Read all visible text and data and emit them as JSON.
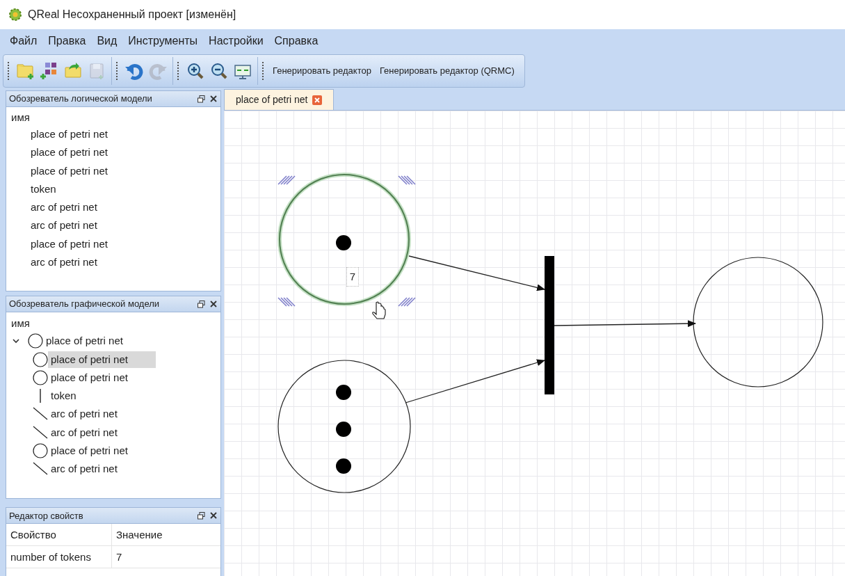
{
  "window": {
    "title": "QReal Несохраненный проект [изменён]"
  },
  "menu": [
    "Файл",
    "Правка",
    "Вид",
    "Инструменты",
    "Настройки",
    "Справка"
  ],
  "toolbar": {
    "groups": [
      [
        {
          "kind": "new-project",
          "disabled": false
        },
        {
          "kind": "new-diagram",
          "disabled": false
        },
        {
          "kind": "open",
          "disabled": false
        },
        {
          "kind": "save",
          "disabled": true
        }
      ],
      [
        {
          "kind": "undo",
          "disabled": false
        },
        {
          "kind": "redo",
          "disabled": true
        }
      ],
      [
        {
          "kind": "zoom-in",
          "disabled": false
        },
        {
          "kind": "zoom-out",
          "disabled": false
        },
        {
          "kind": "fit",
          "disabled": false
        }
      ]
    ],
    "actions": [
      "Генерировать редактор",
      "Генерировать редактор (QRMC)"
    ]
  },
  "logical_explorer": {
    "title": "Обозреватель логической модели",
    "header": "имя",
    "items": [
      "place of petri net",
      "place of petri net",
      "place of petri net",
      "token",
      "arc of petri net",
      "arc of petri net",
      "place of petri net",
      "arc of petri net"
    ]
  },
  "graphic_explorer": {
    "title": "Обозреватель графической модели",
    "header": "имя",
    "items": [
      {
        "label": "place of petri net",
        "kind": "place",
        "expanded": true,
        "selected": false,
        "children": [
          {
            "label": "place of petri net",
            "kind": "place",
            "selected": true
          },
          {
            "label": "place of petri net",
            "kind": "place",
            "selected": false
          },
          {
            "label": "token",
            "kind": "token",
            "selected": false
          },
          {
            "label": "arc of petri net",
            "kind": "arc",
            "selected": false
          },
          {
            "label": "arc of petri net",
            "kind": "arc",
            "selected": false
          },
          {
            "label": "place of petri net",
            "kind": "place",
            "selected": false
          },
          {
            "label": "arc of petri net",
            "kind": "arc",
            "selected": false
          }
        ]
      }
    ]
  },
  "property_editor": {
    "title": "Редактор свойств",
    "columns": [
      "Свойство",
      "Значение"
    ],
    "rows": [
      [
        "number of tokens",
        "7"
      ]
    ]
  },
  "tabs": [
    {
      "label": "place of petri net",
      "selected": true
    }
  ],
  "diagram": {
    "places": [
      {
        "label": "7",
        "selected": true
      },
      {
        "selected": false
      },
      {
        "selected": false
      }
    ]
  }
}
